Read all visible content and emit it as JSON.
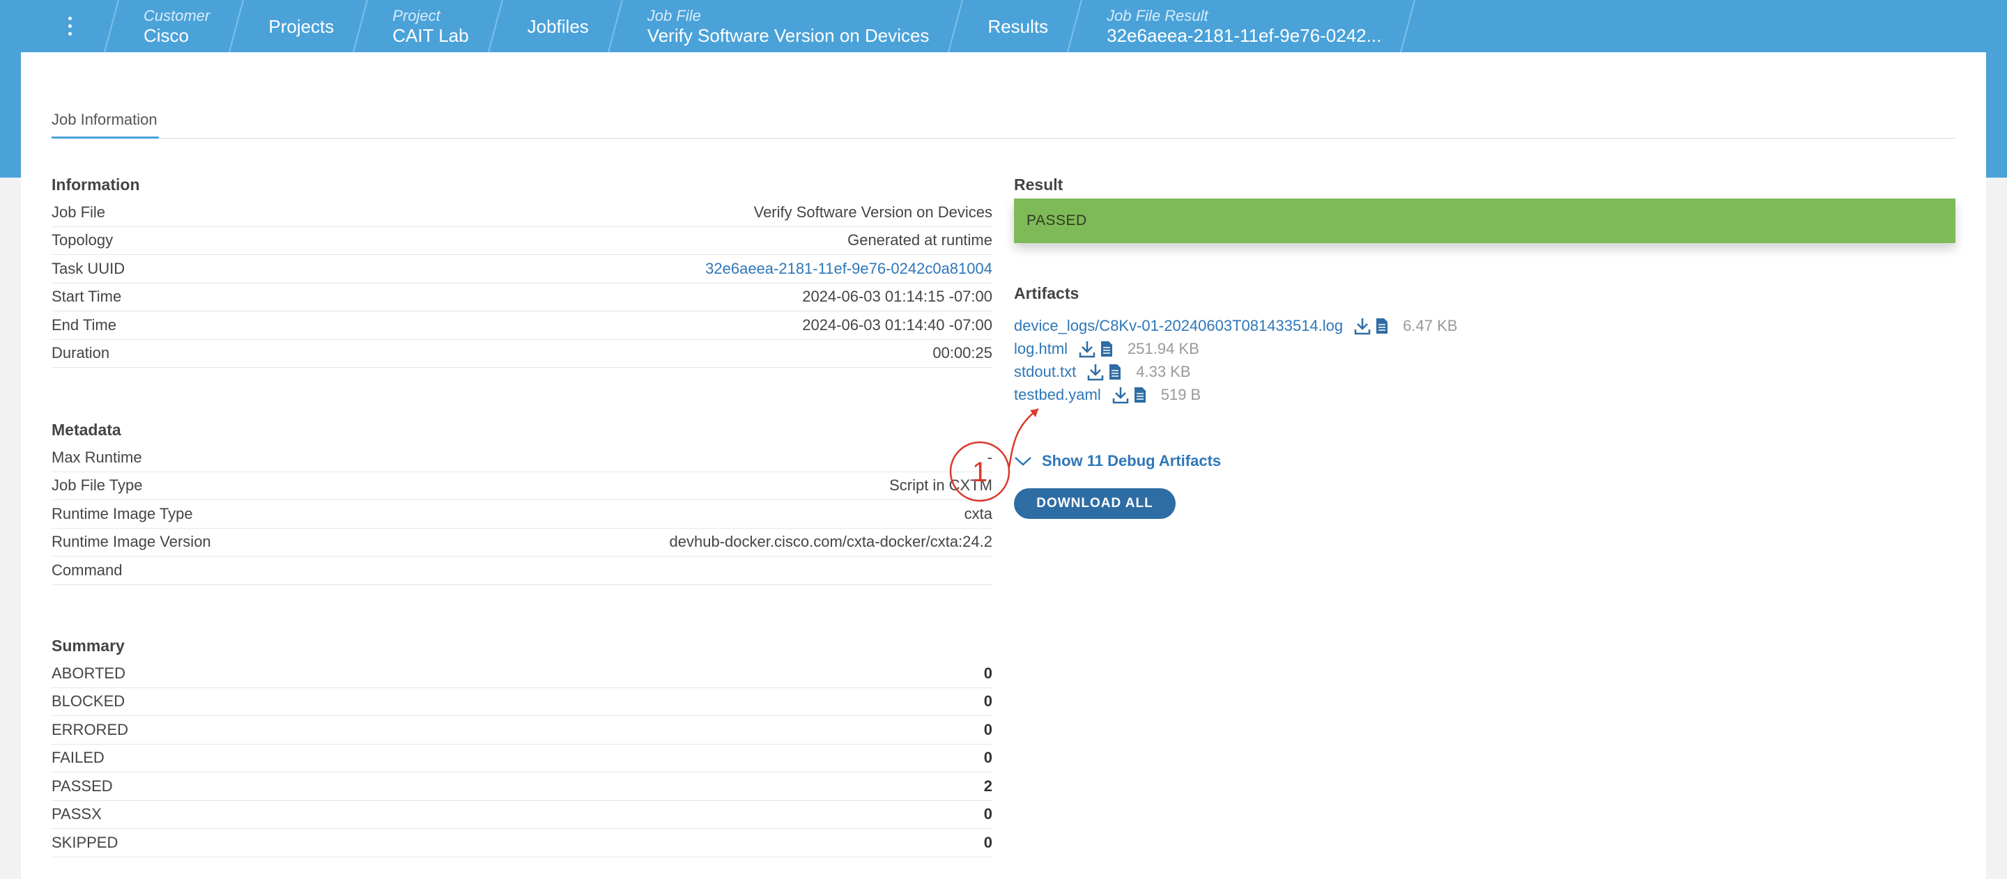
{
  "breadcrumb": {
    "items": [
      {
        "label": "Customer",
        "value": "Cisco"
      },
      {
        "label": "",
        "value": "Projects"
      },
      {
        "label": "Project",
        "value": "CAIT Lab"
      },
      {
        "label": "",
        "value": "Jobfiles"
      },
      {
        "label": "Job File",
        "value": "Verify Software Version on Devices"
      },
      {
        "label": "",
        "value": "Results"
      },
      {
        "label": "Job File Result",
        "value": "32e6aeea-2181-11ef-9e76-0242..."
      }
    ]
  },
  "tabs": [
    {
      "label": "Job Information"
    }
  ],
  "information": {
    "title": "Information",
    "rows": [
      {
        "key": "Job File",
        "value": "Verify Software Version on Devices"
      },
      {
        "key": "Topology",
        "value": "Generated at runtime"
      },
      {
        "key": "Task UUID",
        "value": "32e6aeea-2181-11ef-9e76-0242c0a81004"
      },
      {
        "key": "Start Time",
        "value": "2024-06-03 01:14:15 -07:00"
      },
      {
        "key": "End Time",
        "value": "2024-06-03 01:14:40 -07:00"
      },
      {
        "key": "Duration",
        "value": "00:00:25"
      }
    ]
  },
  "metadata": {
    "title": "Metadata",
    "rows": [
      {
        "key": "Max Runtime",
        "value": "-"
      },
      {
        "key": "Job File Type",
        "value": "Script in CXTM"
      },
      {
        "key": "Runtime Image Type",
        "value": "cxta"
      },
      {
        "key": "Runtime Image Version",
        "value": "devhub-docker.cisco.com/cxta-docker/cxta:24.2"
      },
      {
        "key": "Command",
        "value": ""
      }
    ]
  },
  "summary": {
    "title": "Summary",
    "rows": [
      {
        "key": "ABORTED",
        "value": "0"
      },
      {
        "key": "BLOCKED",
        "value": "0"
      },
      {
        "key": "ERRORED",
        "value": "0"
      },
      {
        "key": "FAILED",
        "value": "0"
      },
      {
        "key": "PASSED",
        "value": "2"
      },
      {
        "key": "PASSX",
        "value": "0"
      },
      {
        "key": "SKIPPED",
        "value": "0"
      }
    ]
  },
  "result": {
    "title": "Result",
    "status": "PASSED",
    "status_color": "#7fba59"
  },
  "artifacts": {
    "title": "Artifacts",
    "items": [
      {
        "name": "device_logs/C8Kv-01-20240603T081433514.log",
        "size": "6.47 KB"
      },
      {
        "name": "log.html",
        "size": "251.94 KB"
      },
      {
        "name": "stdout.txt",
        "size": "4.33 KB"
      },
      {
        "name": "testbed.yaml",
        "size": "519 B"
      }
    ],
    "show_debug_label": "Show 11 Debug Artifacts",
    "download_all_label": "DOWNLOAD ALL"
  },
  "annotation": {
    "number": "1",
    "color": "#d93a2b"
  },
  "colors": {
    "header": "#4aa2d9",
    "link": "#2e77b8",
    "button": "#2e6ca4"
  }
}
